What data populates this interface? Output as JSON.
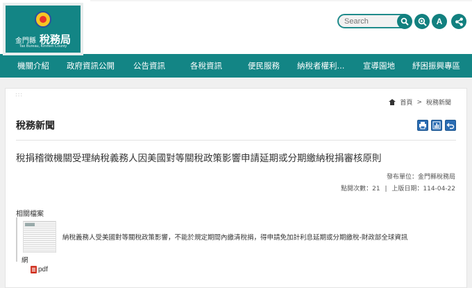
{
  "header": {
    "logo_zh_small": "金門縣",
    "logo_zh_big": "稅務局",
    "logo_en": "Tax Bureau, Kinmen County",
    "search_placeholder": "Search",
    "font_size_label": "A",
    "icons": [
      "search-icon",
      "zoom-search-icon",
      "font-size-icon",
      "share-icon"
    ]
  },
  "nav": {
    "items": [
      "機關介紹",
      "政府資訊公開",
      "公告資訊",
      "各稅資訊",
      "便民服務",
      "納稅者權利...",
      "宣導園地",
      "紓困振興專區"
    ]
  },
  "breadcrumb": {
    "home": "首頁",
    "separator": ">",
    "current": "稅務新聞"
  },
  "page": {
    "section_title": "稅務新聞",
    "tools": [
      "print-icon",
      "chart-icon",
      "back-icon"
    ],
    "headline": "稅捐稽徵機關受理納稅義務人因美國對等關稅政策影響申請延期或分期繳納稅捐審核原則",
    "publisher": "發布單位：金門縣稅務局",
    "clicks": "點閱次數：21",
    "meta_separator": "|",
    "date": "上版日期：114-04-22",
    "related_label": "相關檔案",
    "attachment_desc_1": "納稅義務人受美國對等關稅政策影響，不能於規定期間內繳清稅捐，得申請免加計利息延期或分期繳稅-財政部全球資訊",
    "attachment_desc_2": "網",
    "attachment_type": "pdf"
  },
  "colors": {
    "brand": "#138585",
    "tool_blue": "#2a6cb3",
    "pdf_red": "#d23a2a"
  }
}
